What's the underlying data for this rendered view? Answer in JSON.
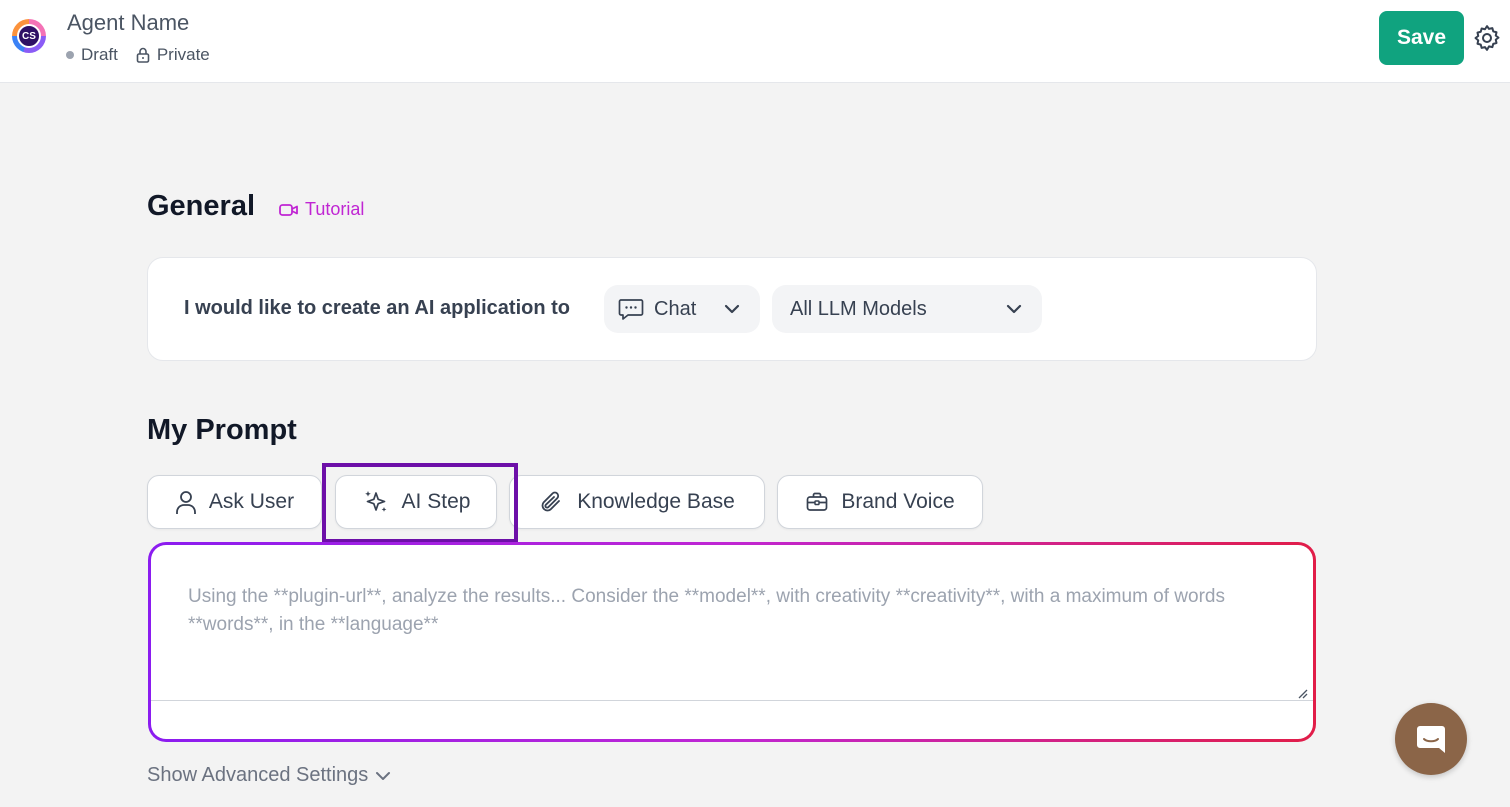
{
  "header": {
    "logo_text": "CS",
    "agent_name": "Agent Name",
    "status": "Draft",
    "visibility": "Private",
    "save_label": "Save"
  },
  "general": {
    "title": "General",
    "tutorial_label": "Tutorial",
    "sentence": "I would like to create an AI application to",
    "mode_select": "Chat",
    "model_select": "All LLM Models"
  },
  "prompt": {
    "title": "My Prompt",
    "tools": [
      "Ask User",
      "AI Step",
      "Knowledge Base",
      "Brand Voice"
    ],
    "placeholder": "Using the **plugin-url**, analyze the results... Consider the **model**, with creativity **creativity**, with a maximum of words **words**, in the **language**",
    "advanced_label": "Show Advanced Settings"
  },
  "colors": {
    "save_bg": "#10a37f",
    "tutorial": "#c026d3",
    "highlight": "#6d0fa8",
    "chat_bubble": "#8b6548"
  }
}
